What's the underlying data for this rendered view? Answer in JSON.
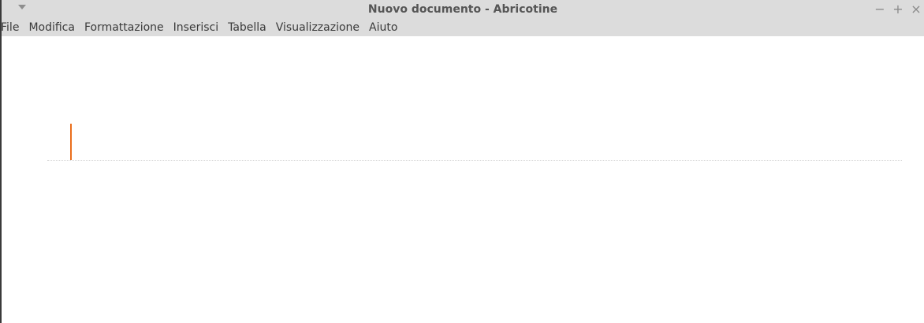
{
  "window": {
    "title": "Nuovo documento - Abricotine",
    "menu_icon": "chevron-down-icon",
    "controls": {
      "minimize": "−",
      "maximize": "+",
      "close": "×"
    }
  },
  "menubar": {
    "items": [
      {
        "label": "File"
      },
      {
        "label": "Modifica"
      },
      {
        "label": "Formattazione"
      },
      {
        "label": "Inserisci"
      },
      {
        "label": "Tabella"
      },
      {
        "label": "Visualizzazione"
      },
      {
        "label": "Aiuto"
      }
    ]
  },
  "editor": {
    "content": "",
    "caret_color": "#ea6e1c"
  }
}
